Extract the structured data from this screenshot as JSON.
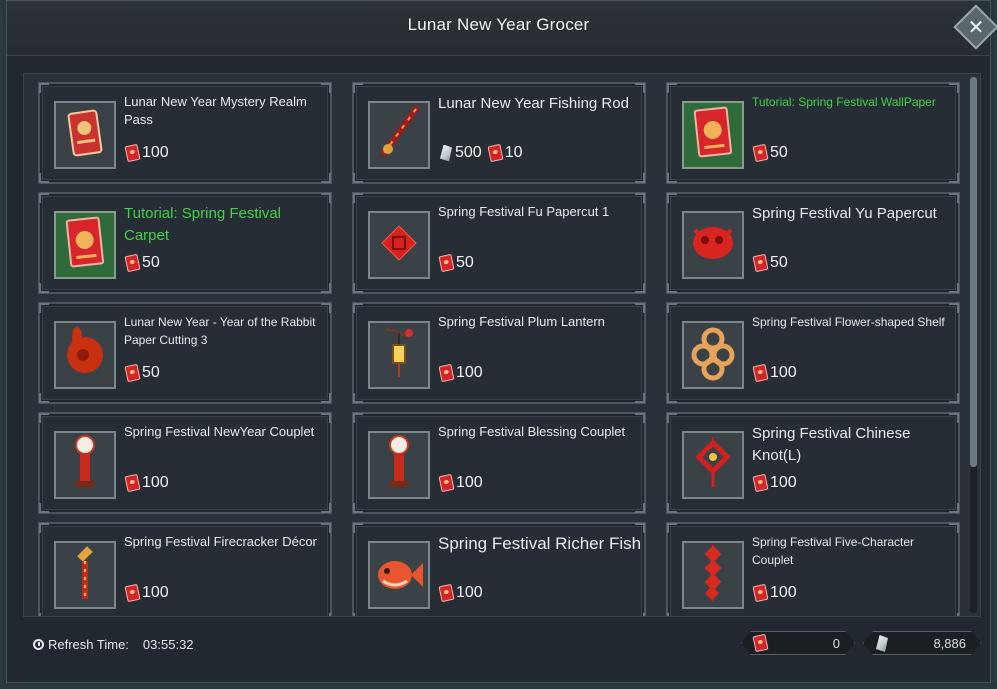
{
  "window": {
    "title": "Lunar New Year Grocer"
  },
  "items": [
    {
      "name": "Lunar New Year Mystery Realm Pass",
      "price": "100",
      "icon": "ticket-icon",
      "style": "normal",
      "thumb": "normal",
      "cost2": ""
    },
    {
      "name": "Lunar New Year Fishing Rod",
      "price": "500",
      "icon": "fishing-rod-icon",
      "style": "big",
      "thumb": "normal",
      "cost2": "10"
    },
    {
      "name": "Tutorial: Spring Festival WallPaper",
      "price": "50",
      "icon": "tutorial-book-icon",
      "style": "green-small",
      "thumb": "green",
      "cost2": ""
    },
    {
      "name": "Tutorial: Spring Festival Carpet",
      "price": "50",
      "icon": "tutorial-book-icon",
      "style": "green-big",
      "thumb": "green",
      "cost2": ""
    },
    {
      "name": "Spring Festival Fu Papercut 1",
      "price": "50",
      "icon": "fu-papercut-icon",
      "style": "normal",
      "thumb": "normal",
      "cost2": ""
    },
    {
      "name": "Spring Festival Yu Papercut",
      "price": "50",
      "icon": "yu-papercut-icon",
      "style": "big",
      "thumb": "normal",
      "cost2": ""
    },
    {
      "name": "Lunar New Year - Year of the Rabbit Paper Cutting 3",
      "price": "50",
      "icon": "rabbit-papercut-icon",
      "style": "small",
      "thumb": "normal",
      "cost2": ""
    },
    {
      "name": "Spring Festival Plum Lantern",
      "price": "100",
      "icon": "lantern-icon",
      "style": "normal",
      "thumb": "normal",
      "cost2": ""
    },
    {
      "name": "Spring Festival Flower-shaped Shelf",
      "price": "100",
      "icon": "shelf-icon",
      "style": "small",
      "thumb": "normal",
      "cost2": ""
    },
    {
      "name": "Spring Festival NewYear Couplet",
      "price": "100",
      "icon": "couplet-icon",
      "style": "normal",
      "thumb": "normal",
      "cost2": ""
    },
    {
      "name": "Spring Festival Blessing Couplet",
      "price": "100",
      "icon": "couplet-icon",
      "style": "normal",
      "thumb": "normal",
      "cost2": ""
    },
    {
      "name": "Spring Festival Chinese Knot(L)",
      "price": "100",
      "icon": "chinese-knot-icon",
      "style": "big",
      "thumb": "normal",
      "cost2": ""
    },
    {
      "name": "Spring Festival Firecracker Décor",
      "price": "100",
      "icon": "firecracker-icon",
      "style": "normal",
      "thumb": "normal",
      "cost2": ""
    },
    {
      "name": "Spring Festival Richer Fish",
      "price": "100",
      "icon": "fish-icon",
      "style": "large",
      "thumb": "normal",
      "cost2": ""
    },
    {
      "name": "Spring Festival Five-Character Couplet",
      "price": "100",
      "icon": "five-char-couplet-icon",
      "style": "small",
      "thumb": "normal",
      "cost2": ""
    }
  ],
  "footer": {
    "refresh_label": "Refresh Time:",
    "refresh_time": "03:55:32",
    "red_envelope_balance": "0",
    "crystal_balance": "8,886"
  },
  "colors": {
    "tutorial_green": "#43d24b",
    "envelope_red": "#d2242a",
    "panel": "#262d34"
  },
  "scrollbar": {
    "position_fraction": 0.0
  }
}
